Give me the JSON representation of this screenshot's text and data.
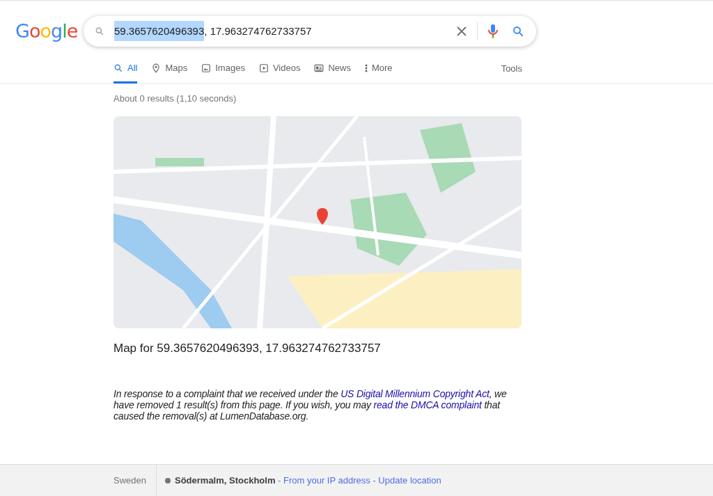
{
  "logo": "Google",
  "search": {
    "selected_text": "59.3657620496393",
    "rest_text": ", 17.963274762733757"
  },
  "tabs": [
    {
      "label": "All",
      "selected": true
    },
    {
      "label": "Maps",
      "selected": false
    },
    {
      "label": "Images",
      "selected": false
    },
    {
      "label": "Videos",
      "selected": false
    },
    {
      "label": "News",
      "selected": false
    },
    {
      "label": "More",
      "selected": false
    }
  ],
  "tools": "Tools",
  "result_stats": "About 0 results (1,10 seconds)",
  "map": {
    "caption": "Map for 59.3657620496393, 17.963274762733757"
  },
  "notice": [
    {
      "kind": "text",
      "text": "In response to a complaint that we received under the "
    },
    {
      "kind": "link",
      "text": "US Digital Millennium Copyright Act"
    },
    {
      "kind": "text",
      "text": ", we have removed 1 result(s) from this page. If you wish, you may "
    },
    {
      "kind": "link",
      "text": "read the DMCA complaint"
    },
    {
      "kind": "text",
      "text": " that caused the removal(s) at LumenDatabase.org."
    }
  ],
  "footer": {
    "country": "Sweden",
    "location": "Södermalm, Stockholm",
    "separator": " - ",
    "links": [
      "From your IP address",
      "Update location"
    ]
  }
}
